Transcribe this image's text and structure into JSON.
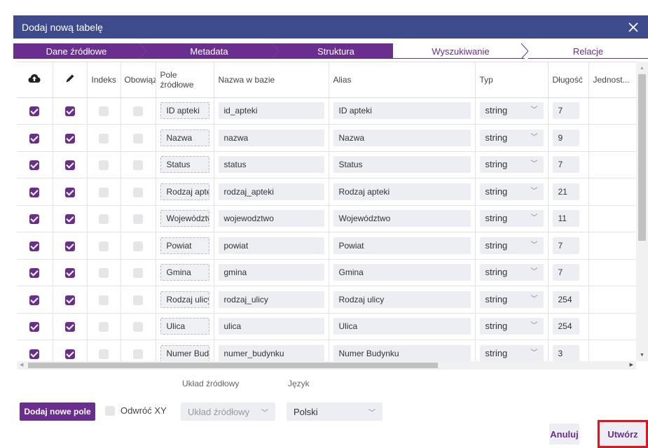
{
  "dialog": {
    "title": "Dodaj nową tabelę"
  },
  "steps": [
    {
      "label": "Dane źródłowe",
      "state": "done"
    },
    {
      "label": "Metadata",
      "state": "done"
    },
    {
      "label": "Struktura",
      "state": "done"
    },
    {
      "label": "Wyszukiwanie",
      "state": "todo"
    },
    {
      "label": "Relacje",
      "state": "todo"
    }
  ],
  "table": {
    "headers": {
      "upload_icon": "cloud-upload-icon",
      "edit_icon": "pencil-icon",
      "index": "Indeks",
      "required": "Obowiązkowe",
      "source_field_line1": "Pole",
      "source_field_line2": "źródłowe",
      "db_name": "Nazwa w bazie",
      "alias": "Alias",
      "type": "Typ",
      "length": "Długość",
      "unit": "Jednost..."
    },
    "rows": [
      {
        "source": "ID apteki",
        "db": "id_apteki",
        "alias": "ID apteki",
        "type": "string",
        "length": "7"
      },
      {
        "source": "Nazwa",
        "db": "nazwa",
        "alias": "Nazwa",
        "type": "string",
        "length": "9"
      },
      {
        "source": "Status",
        "db": "status",
        "alias": "Status",
        "type": "string",
        "length": "7"
      },
      {
        "source": "Rodzaj apteki",
        "db": "rodzaj_apteki",
        "alias": "Rodzaj apteki",
        "type": "string",
        "length": "21"
      },
      {
        "source": "Województwo",
        "db": "wojewodztwo",
        "alias": "Województwo",
        "type": "string",
        "length": "11"
      },
      {
        "source": "Powiat",
        "db": "powiat",
        "alias": "Powiat",
        "type": "string",
        "length": "7"
      },
      {
        "source": "Gmina",
        "db": "gmina",
        "alias": "Gmina",
        "type": "string",
        "length": "7"
      },
      {
        "source": "Rodzaj ulicy",
        "db": "rodzaj_ulicy",
        "alias": "Rodzaj ulicy",
        "type": "string",
        "length": "254"
      },
      {
        "source": "Ulica",
        "db": "ulica",
        "alias": "Ulica",
        "type": "string",
        "length": "254"
      },
      {
        "source": "Numer Budynku",
        "db": "numer_budynku",
        "alias": "Numer Budynku",
        "type": "string",
        "length": "3"
      }
    ]
  },
  "controls": {
    "add_field": "Dodaj nowe pole",
    "invert_xy": "Odwróć XY",
    "source_layout_label": "Układ źródłowy",
    "source_layout_value": "Układ źródłowy",
    "language_label": "Język",
    "language_value": "Polski"
  },
  "actions": {
    "cancel": "Anuluj",
    "create": "Utwórz"
  },
  "colors": {
    "accent": "#6a2e91",
    "titlebar": "#3d4a8c",
    "highlight": "#e8111a"
  }
}
